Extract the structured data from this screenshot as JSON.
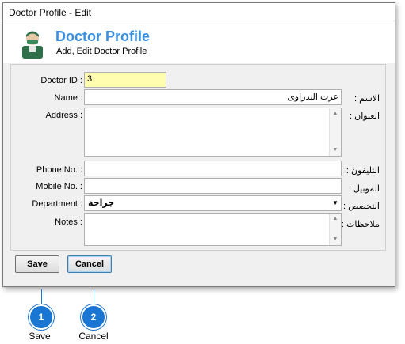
{
  "window": {
    "title": "Doctor Profile - Edit"
  },
  "header": {
    "title": "Doctor Profile",
    "subtitle": "Add, Edit Doctor Profile",
    "avatar_icon": "doctor-avatar-icon"
  },
  "form": {
    "doctor_id": {
      "label": "Doctor ID :",
      "value": "3"
    },
    "name": {
      "label": "Name :",
      "label_ar": "الاسم :",
      "value": "عزت البدراوى"
    },
    "address": {
      "label": "Address :",
      "label_ar": "العنوان :",
      "value": ""
    },
    "phone": {
      "label": "Phone No. :",
      "label_ar": "التليفون :",
      "value": ""
    },
    "mobile": {
      "label": "Mobile No. :",
      "label_ar": "الموبيل :",
      "value": ""
    },
    "department": {
      "label": "Department :",
      "label_ar": "التخصص :",
      "value": "جراحة"
    },
    "notes": {
      "label": "Notes :",
      "label_ar": "ملاحظات :",
      "value": ""
    }
  },
  "buttons": {
    "save": "Save",
    "cancel": "Cancel"
  },
  "callouts": [
    {
      "number": "1",
      "label": "Save"
    },
    {
      "number": "2",
      "label": "Cancel"
    }
  ],
  "colors": {
    "accent": "#3a8fe0",
    "badge": "#1976d2",
    "id_field_bg": "#fffdb0"
  }
}
